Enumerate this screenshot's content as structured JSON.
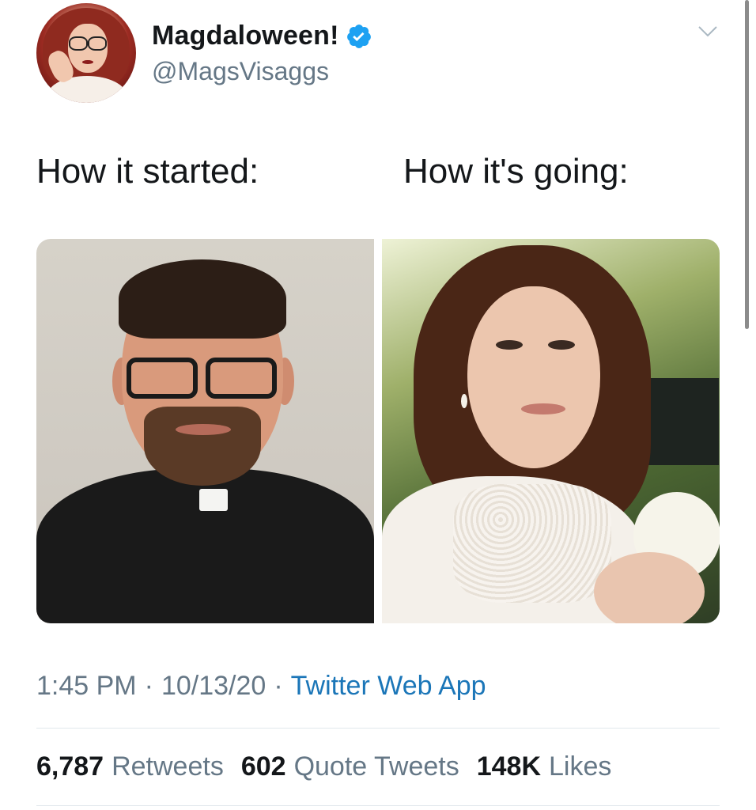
{
  "header": {
    "display_name": "Magdaloween!",
    "handle": "@MagsVisaggs",
    "verified": true,
    "avatar_icon": "cartoon-avatar-redhead-glasses",
    "menu_icon": "chevron-down-icon"
  },
  "tweet": {
    "caption_left": "How it started:",
    "caption_right": "How it's going:",
    "photos": [
      {
        "semantic": "photo-priest-portrait"
      },
      {
        "semantic": "photo-woman-selfie-garden"
      }
    ]
  },
  "meta": {
    "time": "1:45 PM",
    "sep1": "·",
    "date": "10/13/20",
    "sep2": "·",
    "source": "Twitter Web App"
  },
  "stats": {
    "retweets_count": "6,787",
    "retweets_label": "Retweets",
    "quotes_count": "602",
    "quotes_label": "Quote Tweets",
    "likes_count": "148K",
    "likes_label": "Likes"
  },
  "colors": {
    "link": "#1b76b8",
    "muted": "#657786",
    "text": "#14171a",
    "verified": "#1da1f2"
  }
}
